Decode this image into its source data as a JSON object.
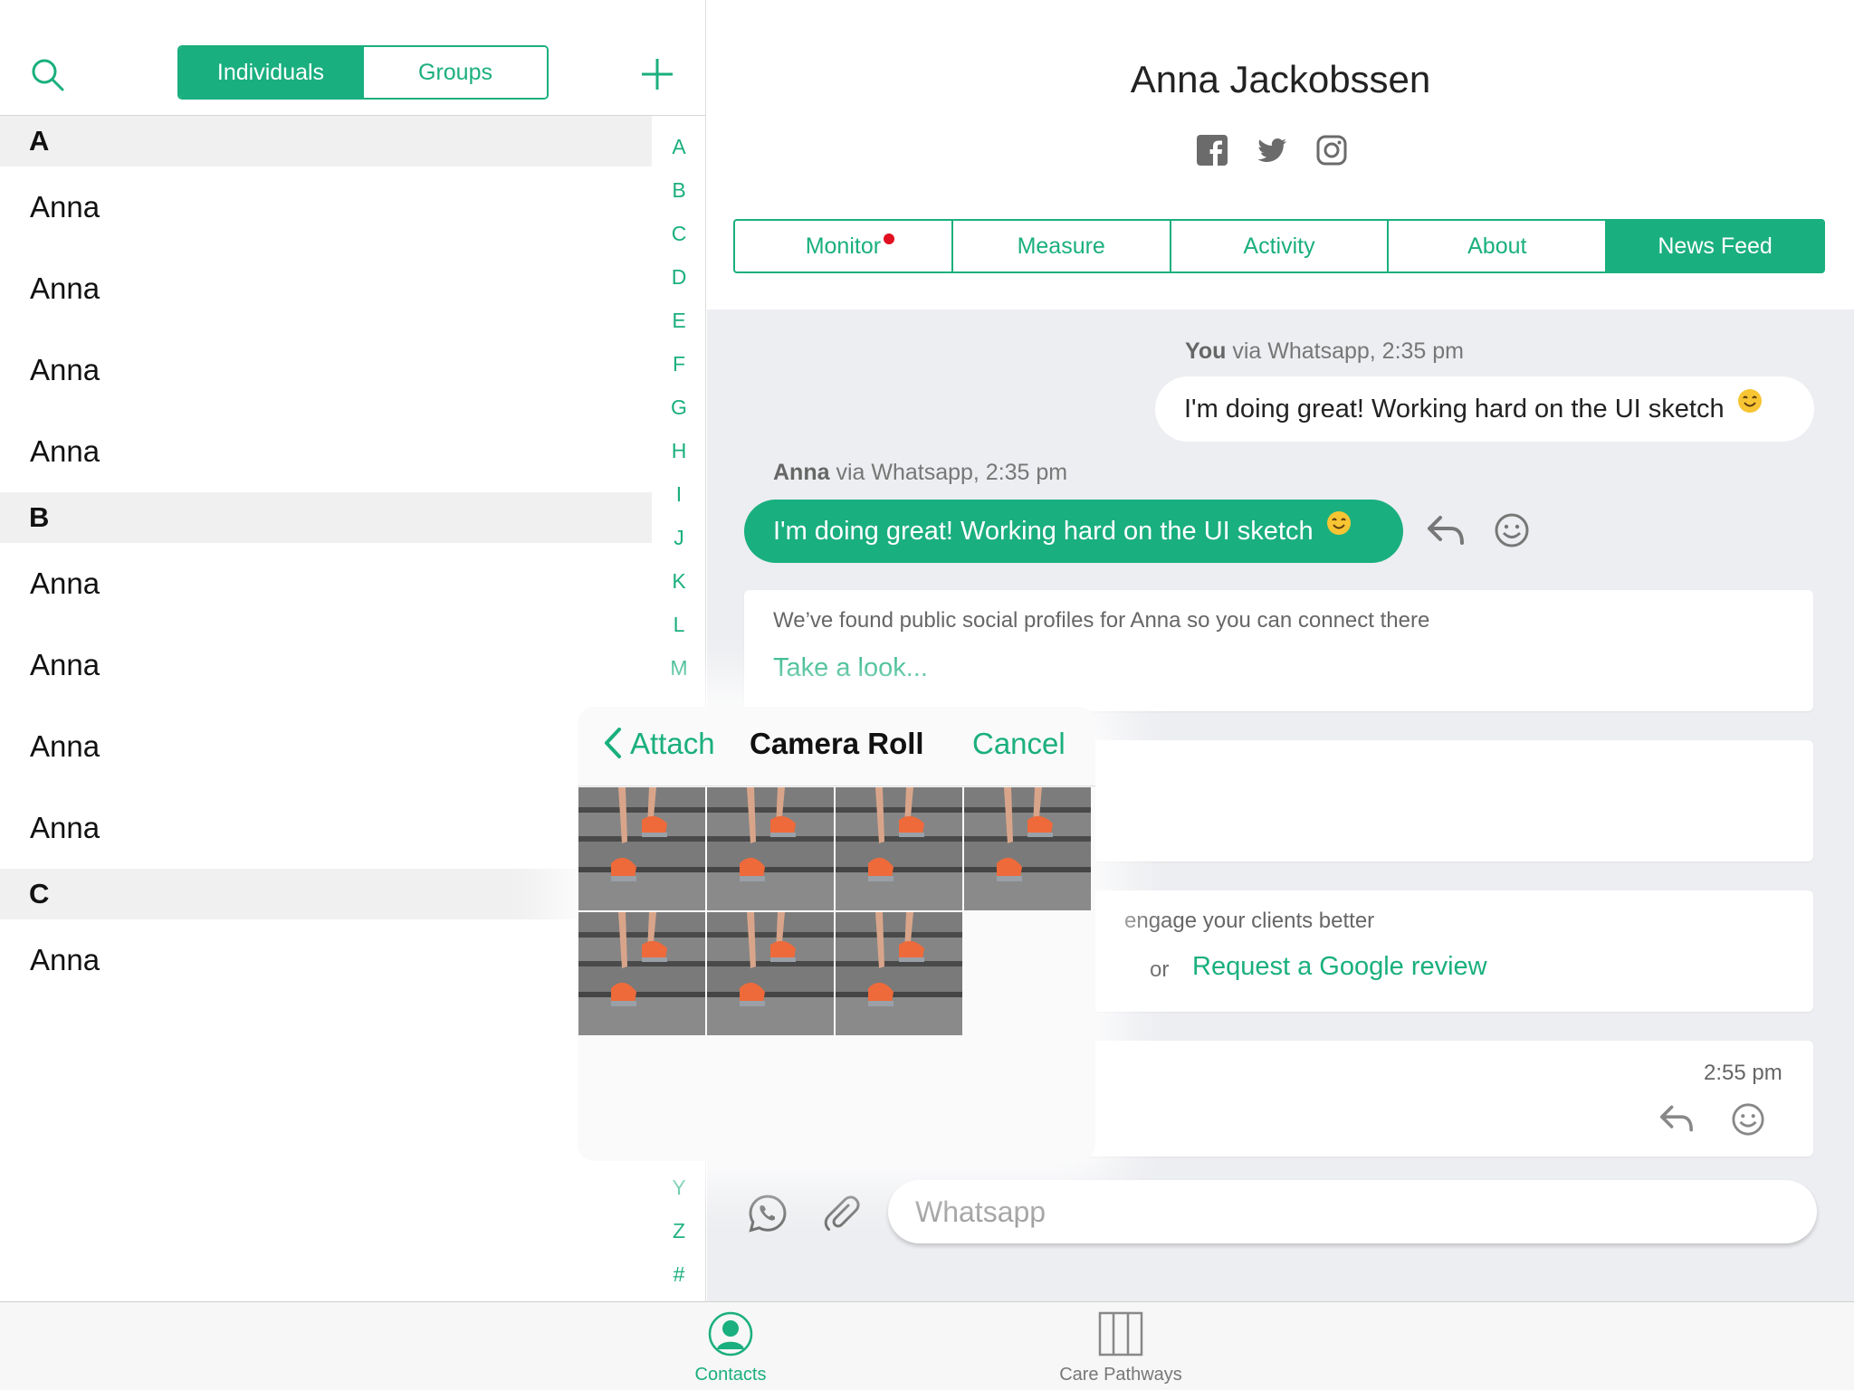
{
  "contacts": {
    "segments": {
      "individuals": "Individuals",
      "groups": "Groups"
    },
    "sections": [
      {
        "letter": "A",
        "rows": [
          "Anna",
          "Anna",
          "Anna",
          "Anna"
        ]
      },
      {
        "letter": "B",
        "rows": [
          "Anna",
          "Anna",
          "Anna",
          "Anna"
        ]
      },
      {
        "letter": "C",
        "rows": [
          "Anna"
        ]
      }
    ],
    "index_top": [
      "A",
      "B",
      "C",
      "D",
      "E",
      "F",
      "G",
      "H",
      "I",
      "J",
      "K",
      "L",
      "M"
    ],
    "index_bottom": [
      "Y",
      "Z",
      "#"
    ]
  },
  "profile": {
    "name": "Anna Jackobssen",
    "tabs": [
      "Monitor",
      "Measure",
      "Activity",
      "About",
      "News Feed"
    ],
    "active_tab": "News Feed",
    "monitor_alert": true
  },
  "feed": {
    "msg1_sender": "You",
    "msg1_meta": " via Whatsapp, 2:35 pm",
    "msg1_text": "I'm doing great! Working hard on the UI sketch",
    "msg2_sender": "Anna",
    "msg2_meta": " via Whatsapp, 2:35 pm",
    "msg2_text": "I'm doing great! Working hard on the UI sketch",
    "card1_text": "We’ve found public social profiles for Anna so you can connect there",
    "card1_link": "Take a look...",
    "card3_text": "engage your clients better",
    "card3_or": "or",
    "card3_link": "Request a Google review",
    "card4_time": "2:55 pm",
    "compose_placeholder": "Whatsapp"
  },
  "popover": {
    "back": "Attach",
    "title": "Camera Roll",
    "cancel": "Cancel",
    "photo_count": 7
  },
  "tabbar": {
    "contacts": "Contacts",
    "care": "Care Pathways"
  },
  "colors": {
    "accent": "#1aaf7e",
    "alert": "#e01020",
    "feed_bg": "#edeef1"
  }
}
